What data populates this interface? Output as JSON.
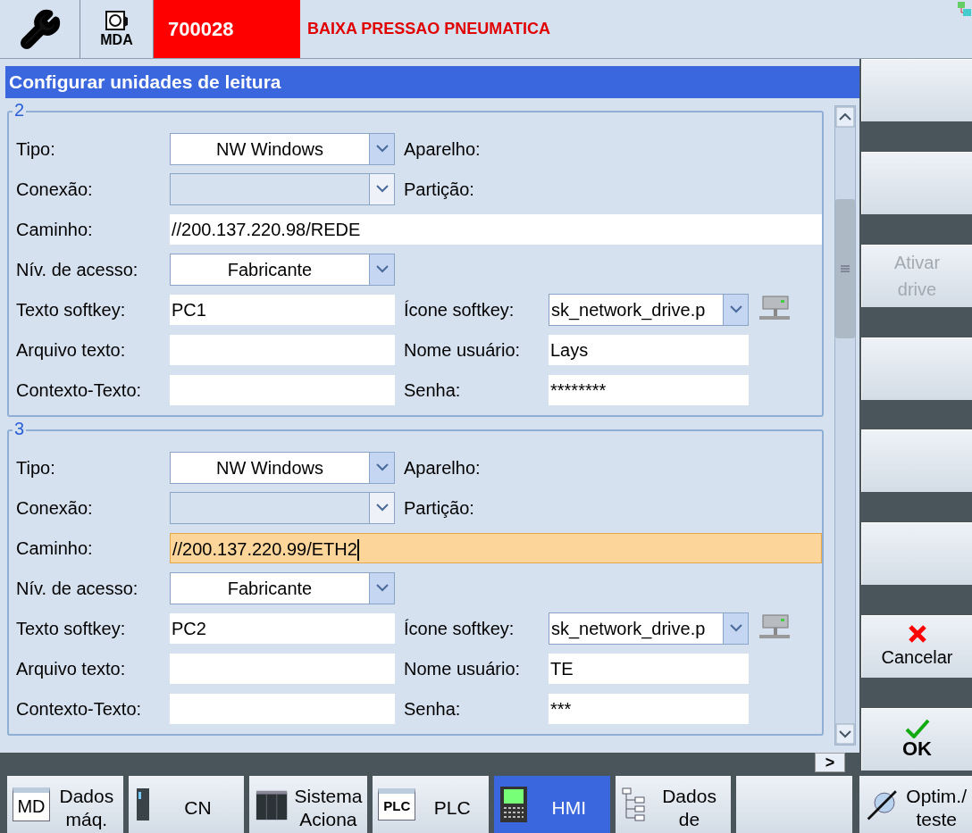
{
  "header": {
    "mode_label": "MDA",
    "alarm_number": "700028",
    "alarm_text": "BAIXA PRESSAO PNEUMATICA"
  },
  "title": "Configurar unidades de leitura",
  "groups": [
    {
      "number": "2",
      "rows": [
        {
          "left": {
            "label": "Tipo:",
            "kind": "dropdown",
            "value": "NW Windows",
            "disabled": false
          },
          "right": {
            "label": "Aparelho:",
            "kind": "none"
          }
        },
        {
          "left": {
            "label": "Conexão:",
            "kind": "dropdown",
            "disabled": true
          },
          "right": {
            "label": "Partição:",
            "kind": "none"
          }
        },
        {
          "left": {
            "label": "Caminho:",
            "kind": "wide",
            "value": "//200.137.220.98/REDE",
            "focused": false
          }
        },
        {
          "left": {
            "label": "Nív. de acesso:",
            "kind": "dropdown",
            "value": "Fabricante",
            "disabled": false
          }
        },
        {
          "left": {
            "label": "Texto softkey:",
            "kind": "input",
            "value": "PC1"
          },
          "right": {
            "label": "Ícone softkey:",
            "kind": "icon_dropdown",
            "value": "sk_network_drive.p"
          }
        },
        {
          "left": {
            "label": "Arquivo texto:",
            "kind": "input"
          },
          "right": {
            "label": "Nome usuário:",
            "kind": "input",
            "value": "Lays"
          }
        },
        {
          "left": {
            "label": "Contexto-Texto:",
            "kind": "input"
          },
          "right": {
            "label": "Senha:",
            "kind": "input",
            "value": "********"
          }
        }
      ]
    },
    {
      "number": "3",
      "rows": [
        {
          "left": {
            "label": "Tipo:",
            "kind": "dropdown",
            "value": "NW Windows",
            "disabled": false
          },
          "right": {
            "label": "Aparelho:",
            "kind": "none"
          }
        },
        {
          "left": {
            "label": "Conexão:",
            "kind": "dropdown",
            "disabled": true
          },
          "right": {
            "label": "Partição:",
            "kind": "none"
          }
        },
        {
          "left": {
            "label": "Caminho:",
            "kind": "wide",
            "value": "//200.137.220.99/ETH2",
            "focused": true
          }
        },
        {
          "left": {
            "label": "Nív. de acesso:",
            "kind": "dropdown",
            "value": "Fabricante",
            "disabled": false
          }
        },
        {
          "left": {
            "label": "Texto softkey:",
            "kind": "input",
            "value": "PC2"
          },
          "right": {
            "label": "Ícone softkey:",
            "kind": "icon_dropdown",
            "value": "sk_network_drive.p"
          }
        },
        {
          "left": {
            "label": "Arquivo texto:",
            "kind": "input"
          },
          "right": {
            "label": "Nome usuário:",
            "kind": "input",
            "value": "TE"
          }
        },
        {
          "left": {
            "label": "Contexto-Texto:",
            "kind": "input"
          },
          "right": {
            "label": "Senha:",
            "kind": "input",
            "value": "***"
          }
        }
      ]
    }
  ],
  "vertical_softkeys": [
    {
      "kind": "blank"
    },
    {
      "kind": "blank"
    },
    {
      "kind": "text",
      "label": "Ativar drive",
      "disabled": true
    },
    {
      "kind": "blank"
    },
    {
      "kind": "blank"
    },
    {
      "kind": "blank"
    },
    {
      "kind": "cancel",
      "label": "Cancelar",
      "disabled": false
    },
    {
      "kind": "ok",
      "label": "OK",
      "disabled": false
    }
  ],
  "scroll_right_label": ">",
  "horizontal_softkeys": [
    {
      "kind": "md",
      "icon_text": "MD",
      "label": "Dados máq.",
      "selected": false
    },
    {
      "kind": "drive",
      "label": "CN",
      "selected": false
    },
    {
      "kind": "cabinet",
      "label": "Sistema Aciona",
      "selected": false
    },
    {
      "kind": "plc",
      "icon_text": "PLC",
      "label": "PLC",
      "selected": false
    },
    {
      "kind": "hmi",
      "label": "HMI",
      "selected": true
    },
    {
      "kind": "tree",
      "label": "Dados de",
      "selected": false
    },
    {
      "kind": "blank",
      "selected": false
    },
    {
      "kind": "optim",
      "label": "Optim./ teste",
      "selected": false
    }
  ]
}
